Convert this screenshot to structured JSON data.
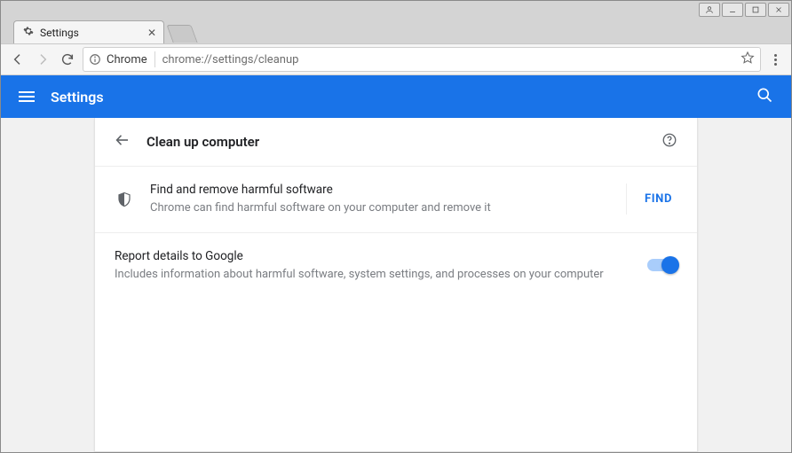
{
  "os": {
    "user_icon": "user-icon",
    "minimize_icon": "minimize-icon",
    "maximize_icon": "maximize-icon",
    "close_icon": "close-icon"
  },
  "tab": {
    "title": "Settings",
    "icon": "gear-icon"
  },
  "toolbar": {
    "secure_label": "Chrome",
    "url": "chrome://settings/cleanup",
    "info_icon": "info-icon",
    "star_icon": "star-icon"
  },
  "header": {
    "title": "Settings",
    "menu_icon": "hamburger-icon",
    "search_icon": "search-icon"
  },
  "page": {
    "back_icon": "arrow-left-icon",
    "section_title": "Clean up computer",
    "help_icon": "help-icon",
    "rows": [
      {
        "icon": "shield-icon",
        "primary": "Find and remove harmful software",
        "secondary": "Chrome can find harmful software on your computer and remove it",
        "action_label": "FIND"
      },
      {
        "primary": "Report details to Google",
        "secondary": "Includes information about harmful software, system settings, and processes on your computer",
        "toggle_on": true
      }
    ]
  }
}
